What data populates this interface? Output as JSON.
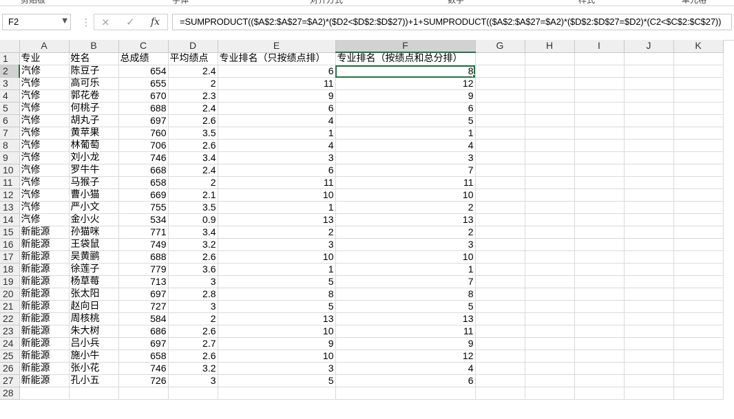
{
  "ribbon": {
    "groups": [
      "剪贴板",
      "字体",
      "对齐方式",
      "数字",
      "样式",
      "单元格"
    ]
  },
  "formula_bar": {
    "name_box": "F2",
    "cancel_icon": "×",
    "enter_icon": "✓",
    "fx_label": "fx",
    "formula": "=SUMPRODUCT(($A$2:$A$27=$A2)*($D2<$D$2:$D$27))+1+SUMPRODUCT(($A$2:$A$27=$A2)*($D$2:$D$27=$D2)*(C2<$C$2:$C$27))"
  },
  "columns": [
    "A",
    "B",
    "C",
    "D",
    "E",
    "F",
    "G",
    "H",
    "I",
    "J",
    "K"
  ],
  "header_row": [
    "专业",
    "姓名",
    "总成绩",
    "平均绩点",
    "专业排名（只按绩点排）",
    "专业排名（按绩点和总分排）"
  ],
  "rows": [
    [
      "汽修",
      "陈豆子",
      "654",
      "2.4",
      "6",
      "8"
    ],
    [
      "汽修",
      "高可乐",
      "655",
      "2",
      "11",
      "12"
    ],
    [
      "汽修",
      "郭花卷",
      "670",
      "2.3",
      "9",
      "9"
    ],
    [
      "汽修",
      "何桃子",
      "688",
      "2.4",
      "6",
      "6"
    ],
    [
      "汽修",
      "胡丸子",
      "697",
      "2.6",
      "4",
      "5"
    ],
    [
      "汽修",
      "黄苹果",
      "760",
      "3.5",
      "1",
      "1"
    ],
    [
      "汽修",
      "林葡萄",
      "706",
      "2.6",
      "4",
      "4"
    ],
    [
      "汽修",
      "刘小龙",
      "746",
      "3.4",
      "3",
      "3"
    ],
    [
      "汽修",
      "罗牛牛",
      "668",
      "2.4",
      "6",
      "7"
    ],
    [
      "汽修",
      "马猴子",
      "658",
      "2",
      "11",
      "11"
    ],
    [
      "汽修",
      "曹小猫",
      "669",
      "2.1",
      "10",
      "10"
    ],
    [
      "汽修",
      "严小文",
      "755",
      "3.5",
      "1",
      "2"
    ],
    [
      "汽修",
      "金小火",
      "534",
      "0.9",
      "13",
      "13"
    ],
    [
      "新能源",
      "孙猫咪",
      "771",
      "3.4",
      "2",
      "2"
    ],
    [
      "新能源",
      "王袋鼠",
      "749",
      "3.2",
      "3",
      "3"
    ],
    [
      "新能源",
      "吴黄鹂",
      "688",
      "2.6",
      "10",
      "10"
    ],
    [
      "新能源",
      "徐莲子",
      "779",
      "3.6",
      "1",
      "1"
    ],
    [
      "新能源",
      "杨草莓",
      "713",
      "3",
      "5",
      "7"
    ],
    [
      "新能源",
      "张太阳",
      "697",
      "2.8",
      "8",
      "8"
    ],
    [
      "新能源",
      "赵向日",
      "727",
      "3",
      "5",
      "5"
    ],
    [
      "新能源",
      "周核桃",
      "584",
      "2",
      "13",
      "13"
    ],
    [
      "新能源",
      "朱大树",
      "686",
      "2.6",
      "10",
      "11"
    ],
    [
      "新能源",
      "吕小兵",
      "697",
      "2.7",
      "9",
      "9"
    ],
    [
      "新能源",
      "施小牛",
      "658",
      "2.6",
      "10",
      "12"
    ],
    [
      "新能源",
      "张小花",
      "746",
      "3.2",
      "3",
      "4"
    ],
    [
      "新能源",
      "孔小五",
      "726",
      "3",
      "5",
      "6"
    ]
  ],
  "row_numbers": [
    "1",
    "2",
    "3",
    "4",
    "5",
    "6",
    "7",
    "8",
    "9",
    "10",
    "11",
    "12",
    "13",
    "14",
    "15",
    "16",
    "17",
    "18",
    "19",
    "20",
    "21",
    "22",
    "23",
    "24",
    "25",
    "26",
    "27",
    "28"
  ],
  "selected_cell": {
    "col": "F",
    "row": "2"
  },
  "colors": {
    "accent": "#217346",
    "header_bg": "#efefef",
    "gridline": "#dadada"
  }
}
